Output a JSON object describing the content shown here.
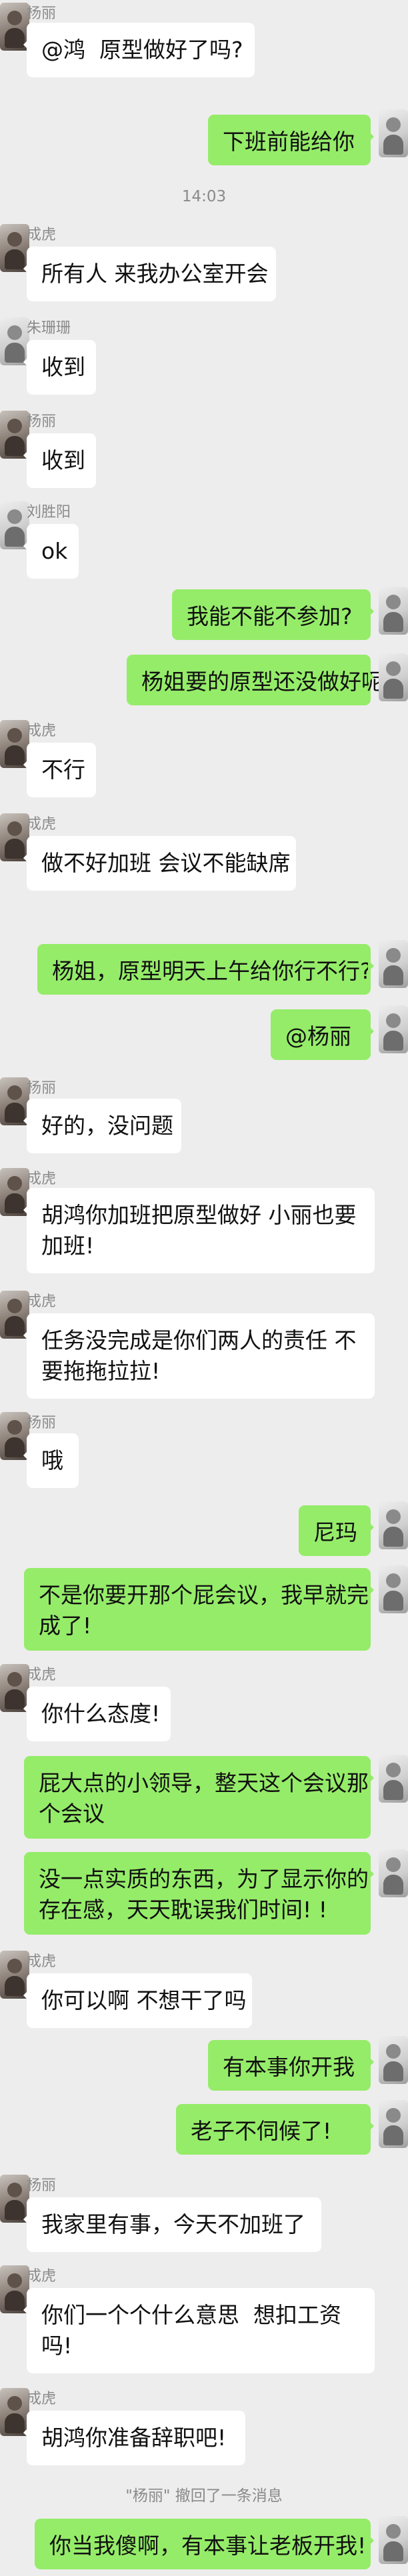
{
  "messages": [
    {
      "sender": "杨丽",
      "text": "@鸿  原型做好了吗?"
    },
    {
      "text": "下班前能给你"
    },
    {
      "time": "14:03"
    },
    {
      "sender": "成虎",
      "text": "所有人 来我办公室开会"
    },
    {
      "sender": "朱珊珊",
      "text": "收到"
    },
    {
      "sender": "杨丽",
      "text": "收到"
    },
    {
      "sender": "刘胜阳",
      "text": "ok"
    },
    {
      "text": "我能不能不参加?"
    },
    {
      "text": "杨姐要的原型还没做好呢"
    },
    {
      "sender": "成虎",
      "text": "不行"
    },
    {
      "sender": "成虎",
      "text": "做不好加班 会议不能缺席"
    },
    {
      "text": "杨姐，原型明天上午给你行不行?"
    },
    {
      "text": "@杨丽"
    },
    {
      "sender": "杨丽",
      "text": "好的，没问题"
    },
    {
      "sender": "成虎",
      "text": "胡鸿你加班把原型做好 小丽也要\n加班!"
    },
    {
      "sender": "成虎",
      "text": "任务没完成是你们两人的责任 不\n要拖拖拉拉!"
    },
    {
      "sender": "杨丽",
      "text": "哦"
    },
    {
      "text": "尼玛"
    },
    {
      "text": "不是你要开那个屁会议，我早就完\n成了!"
    },
    {
      "sender": "成虎",
      "text": "你什么态度!"
    },
    {
      "text": "屁大点的小领导，整天这个会议那\n个会议"
    },
    {
      "text": "没一点实质的东西，为了显示你的\n存在感，天天耽误我们时间! !"
    },
    {
      "sender": "成虎",
      "text": "你可以啊 不想干了吗"
    },
    {
      "text": "有本事你开我"
    },
    {
      "text": "老子不伺候了!"
    },
    {
      "sender": "杨丽",
      "text": "我家里有事，今天不加班了"
    },
    {
      "sender": "成虎",
      "text": "你们一个个什么意思  想扣工资\n吗!"
    },
    {
      "sender": "成虎",
      "text": "胡鸿你准备辞职吧!"
    },
    {
      "recall": "\"杨丽\" 撤回了一条消息"
    },
    {
      "text": "你当我傻啊，有本事让老板开我!"
    }
  ]
}
